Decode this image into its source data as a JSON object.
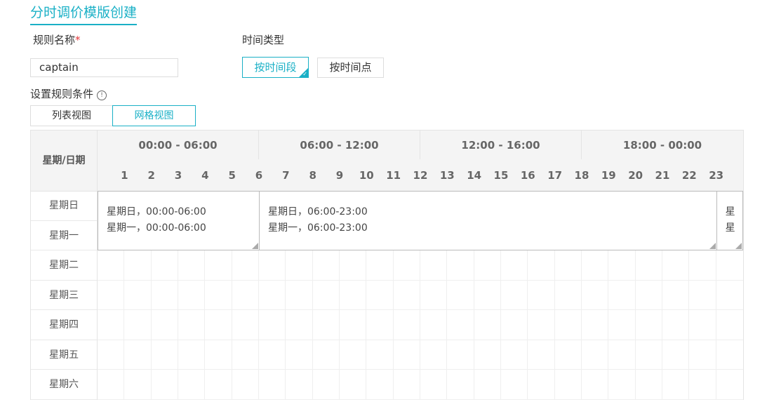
{
  "page": {
    "title": "分时调价模版创建"
  },
  "form": {
    "rule_name_label": "规则名称",
    "required_mark": "*",
    "rule_name_value": "captain",
    "time_type_label": "时间类型",
    "time_type_options": [
      "按时间段",
      "按时间点"
    ],
    "time_type_selected": "按时间段",
    "conditions_label": "设置规则条件",
    "info_glyph": "!",
    "view_tabs": [
      "列表视图",
      "网格视图"
    ],
    "view_selected": "网格视图"
  },
  "grid": {
    "corner_label": "星期/日期",
    "ranges": [
      "00:00 - 06:00",
      "06:00 - 12:00",
      "12:00 - 16:00",
      "18:00 - 00:00"
    ],
    "hours": [
      "1",
      "2",
      "3",
      "4",
      "5",
      "6",
      "7",
      "8",
      "9",
      "10",
      "11",
      "12",
      "13",
      "14",
      "15",
      "16",
      "17",
      "18",
      "19",
      "20",
      "21",
      "22",
      "23"
    ],
    "days": [
      "星期日",
      "星期一",
      "星期二",
      "星期三",
      "星期四",
      "星期五",
      "星期六"
    ],
    "blocks": [
      {
        "lines": [
          "星期日，00:00-06:00",
          "星期一，00:00-06:00"
        ]
      },
      {
        "lines": [
          "星期日，06:00-23:00",
          "星期一，06:00-23:00"
        ]
      },
      {
        "lines": [
          "星",
          "星"
        ]
      }
    ]
  },
  "colors": {
    "accent": "#1ab0c6",
    "required": "#e4393c",
    "header_bg": "#f4f4f4"
  }
}
